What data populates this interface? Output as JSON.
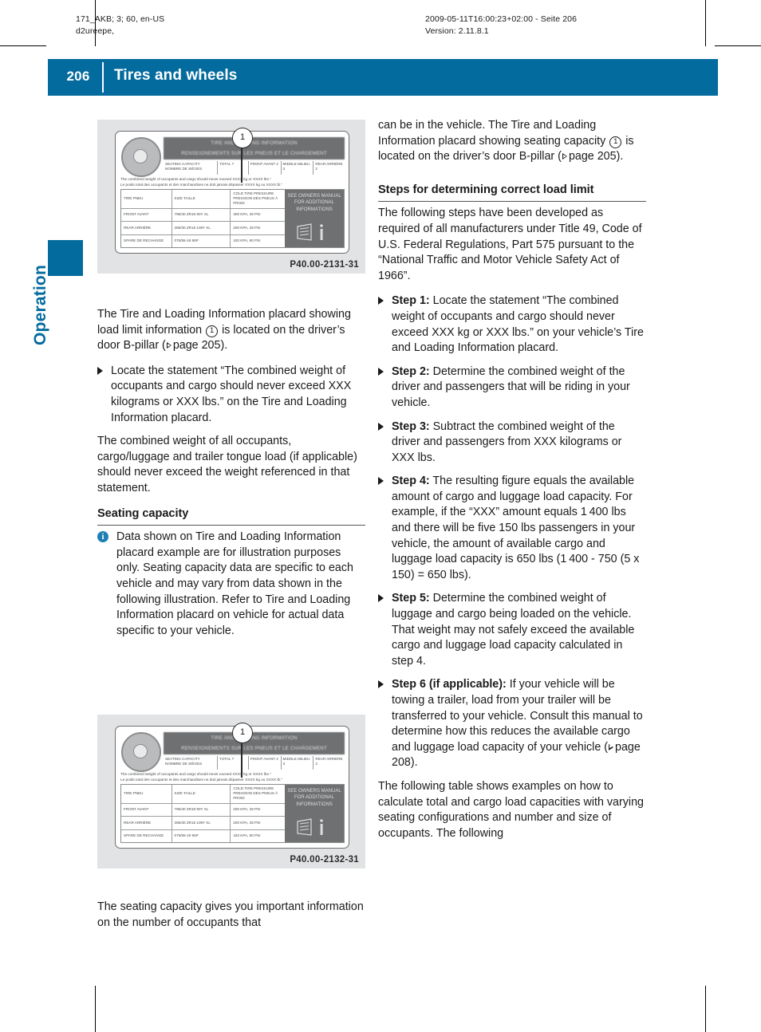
{
  "runhead": {
    "left": "171_AKB; 3; 60, en-US\nd2ureepe,",
    "left_line1": "171_AKB; 3; 60, en-US",
    "left_line2": "d2ureepe,",
    "right_line1": "2009-05-11T16:00:23+02:00 - Seite 206",
    "right_line2": "Version: 2.11.8.1"
  },
  "header": {
    "page_number": "206",
    "title": "Tires and wheels",
    "accent_color": "#046b9e"
  },
  "chapter_tab": {
    "label": "Operation",
    "color": "#046b9e"
  },
  "figures": [
    {
      "caption": "P40.00-2131-31",
      "callout": "1",
      "placard": {
        "title_line1": "TIRE AND LOADING INFORMATION",
        "title_line2": "RENSEIGNEMENTS SUR LES PNEUS ET LE CHARGEMENT",
        "seating_label_line1": "SEATING CAPACITY",
        "seating_label_line2": "NOMBRE DE SIÈGES",
        "seating_cells": [
          {
            "label": "TOTAL",
            "value": "7"
          },
          {
            "label": "FRONT\nAVANT",
            "value": "2"
          },
          {
            "label": "MIDDLE\nMILIEU",
            "value": "3"
          },
          {
            "label": "REAR\nARRIÈRE",
            "value": "2"
          }
        ],
        "statement_line1": "The combined weight of occupants and cargo should never exceed XXXX kg or XXXX lbs.\"",
        "statement_line2": "Le poids total des occupants et des marchandises ne doit jamais dépasser XXXX kg ou XXXX lb.\"",
        "rows": [
          {
            "c1": "TIRE\nPNEU",
            "c2": "SIZE\nTAILLE",
            "c3": "COLD TIRE PRESSURE\nPRESSION DES\nPNEUS À FROID"
          },
          {
            "c1": "FRONT\nAVANT",
            "c2": "795/40 ZR18 90Y XL",
            "c3": "300 KPA, 29 PSI"
          },
          {
            "c1": "REAR\nARRIÈRE",
            "c2": "286/30 ZR18 109Y XL",
            "c3": "200 KPA, 29 PSI"
          },
          {
            "c1": "SPARE\nDE RECHANGE",
            "c2": "075/55-19 95P",
            "c3": "420 KPA, 60 PSI"
          }
        ],
        "manual_text": "SEE OWNERS MANUAL FOR ADDITIONAL INFORMATIONS"
      }
    },
    {
      "caption": "P40.00-2132-31",
      "callout": "1",
      "placard": {
        "title_line1": "TIRE AND LOADING INFORMATION",
        "title_line2": "RENSEIGNEMENTS SUR LES PNEUS ET LE CHARGEMENT",
        "seating_label_line1": "SEATING CAPACITY",
        "seating_label_line2": "NOMBRE DE SIÈGES",
        "seating_cells": [
          {
            "label": "TOTAL",
            "value": "7"
          },
          {
            "label": "FRONT\nAVANT",
            "value": "2"
          },
          {
            "label": "MIDDLE\nMILIEU",
            "value": "3"
          },
          {
            "label": "REAR\nARRIÈRE",
            "value": "2"
          }
        ],
        "statement_line1": "The combined weight of occupants and cargo should never exceed XXXX kg or XXXX lbs.\"",
        "statement_line2": "Le poids total des occupants et des marchandises ne doit jamais dépasser XXXX kg ou XXXX lb.\"",
        "rows": [
          {
            "c1": "TIRE\nPNEU",
            "c2": "SIZE\nTAILLE",
            "c3": "COLD TIRE PRESSURE\nPRESSION DES\nPNEUS À FROID"
          },
          {
            "c1": "FRONT\nAVANT",
            "c2": "795/40 ZR18 90Y XL",
            "c3": "200 KPA, 29 PSI"
          },
          {
            "c1": "REAR\nARRIÈRE",
            "c2": "286/30 ZR18 109Y XL",
            "c3": "200 KPA, 29 PSI"
          },
          {
            "c1": "SPARE\nDE RECHANGE",
            "c2": "075/55-19 95P",
            "c3": "420 KPA, 60 PSI"
          }
        ],
        "manual_text": "SEE OWNERS MANUAL FOR ADDITIONAL INFORMATIONS"
      }
    }
  ],
  "left_column": {
    "para1_a": "The Tire and Loading Information placard showing load limit information ",
    "para1_callout": "1",
    "para1_b": " is located on the driver’s door B-pillar (",
    "para1_ref": "page 205",
    "para1_c": ").",
    "bullet1": "Locate the statement “The combined weight of occupants and cargo should never exceed XXX kilograms or XXX lbs.” on the Tire and Loading Information placard.",
    "para2": "The combined weight of all occupants, cargo/luggage and trailer tongue load (if applicable) should never exceed the weight referenced in that statement.",
    "section_heading": "Seating capacity",
    "note": "Data shown on Tire and Loading Information placard example are for illustration purposes only. Seating capacity data are specific to each vehicle and may vary from data shown in the following illustration. Refer to Tire and Loading Information placard on vehicle for actual data specific to your vehicle.",
    "para3": "The seating capacity gives you important information on the number of occupants that"
  },
  "right_column": {
    "para1_a": "can be in the vehicle. The Tire and Loading Information placard showing seating capacity ",
    "para1_callout": "1",
    "para1_b": " is located on the driver’s door B-pillar (",
    "para1_ref": "page 205",
    "para1_c": ").",
    "section_heading": "Steps for determining correct load limit",
    "para2": "The following steps have been developed as required of all manufacturers under Title 49, Code of U.S. Federal Regulations, Part 575 pursuant to the “National Traffic and Motor Vehicle Safety Act of 1966”.",
    "steps": [
      {
        "label": "Step 1:",
        "text": " Locate the statement “The combined weight of occupants and cargo should never exceed XXX kg or XXX lbs.” on your vehicle’s Tire and Loading Information placard."
      },
      {
        "label": "Step 2:",
        "text": " Determine the combined weight of the driver and passengers that will be riding in your vehicle."
      },
      {
        "label": "Step 3:",
        "text": " Subtract the combined weight of the driver and passengers from XXX kilograms or XXX lbs."
      },
      {
        "label": "Step 4:",
        "text": " The resulting figure equals the available amount of cargo and luggage load capacity. For example, if the “XXX” amount equals 1 400 lbs and there will be five 150 lbs passengers in your vehicle, the amount of available cargo and luggage load capacity is 650 lbs (1 400 - 750 (5 x 150) = 650 lbs)."
      },
      {
        "label": "Step 5:",
        "text": " Determine the combined weight of luggage and cargo being loaded on the vehicle. That weight may not safely exceed the available cargo and luggage load capacity calculated in step 4."
      }
    ],
    "step6_label": "Step 6 (if applicable):",
    "step6_a": " If your vehicle will be towing a trailer, load from your trailer will be transferred to your vehicle. Consult this manual to determine how this reduces the available cargo and luggage load capacity of your vehicle (",
    "step6_ref": "page 208",
    "step6_b": ").",
    "para3": "The following table shows examples on how to calculate total and cargo load capacities with varying seating configurations and number and size of occupants. The following"
  }
}
